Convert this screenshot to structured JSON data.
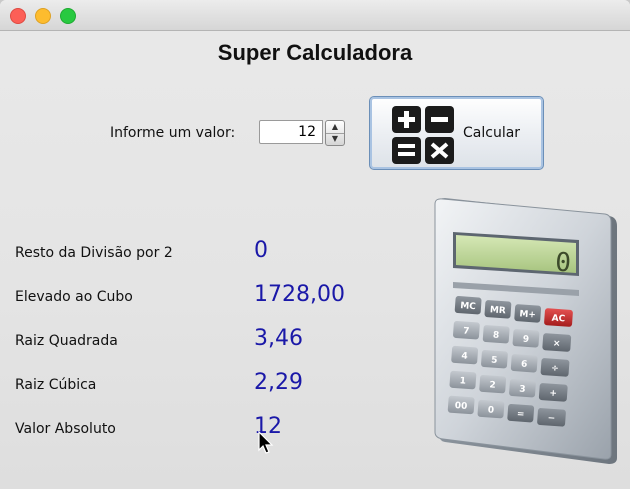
{
  "window": {
    "title": "Super Calculadora",
    "controls": [
      "close",
      "minimize",
      "maximize"
    ]
  },
  "input": {
    "label": "Informe um valor:",
    "value": "12"
  },
  "calculate_button": {
    "label": "Calcular",
    "icon": "math-operations-icon"
  },
  "results": [
    {
      "label": "Resto da Divisão por 2",
      "value": "0"
    },
    {
      "label": "Elevado ao Cubo",
      "value": "1728,00"
    },
    {
      "label": "Raiz Quadrada",
      "value": "3,46"
    },
    {
      "label": "Raiz Cúbica",
      "value": "2,29"
    },
    {
      "label": "Valor Absoluto",
      "value": "12"
    }
  ],
  "illustration": {
    "icon": "calculator-illustration",
    "display": "0",
    "keys": [
      "MC",
      "MR",
      "M+",
      "AC",
      "7",
      "8",
      "9",
      "×",
      "4",
      "5",
      "6",
      "÷",
      "1",
      "2",
      "3",
      "+",
      "00",
      "0",
      "=",
      "−"
    ]
  },
  "colors": {
    "value_text": "#1a18a8",
    "button_border": "#6b8fb8",
    "close": "#fc5f57",
    "minimize": "#fdbc2e",
    "maximize": "#28c940"
  }
}
